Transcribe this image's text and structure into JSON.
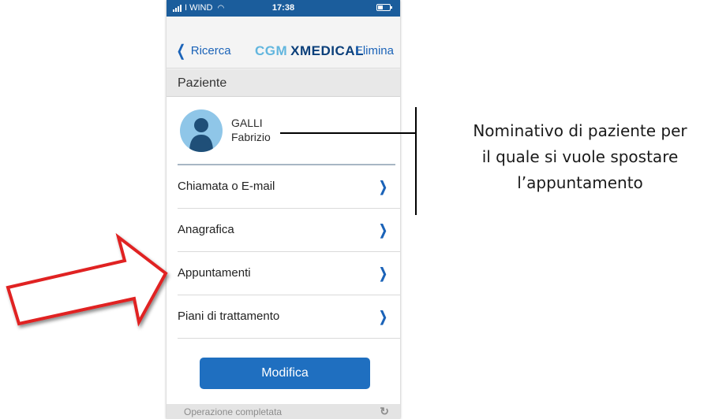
{
  "status_bar": {
    "carrier": "I WIND",
    "time": "17:38"
  },
  "nav": {
    "back_label": "Ricerca",
    "brand_cgm": "CGM",
    "brand_product": "XMEDICAL",
    "delete_label": "Elimina"
  },
  "section": {
    "title": "Paziente"
  },
  "patient": {
    "last_name": "GALLI",
    "first_name": "Fabrizio"
  },
  "menu": [
    {
      "label": "Chiamata o E-mail"
    },
    {
      "label": "Anagrafica"
    },
    {
      "label": "Appuntamenti"
    },
    {
      "label": "Piani di trattamento"
    }
  ],
  "actions": {
    "modify_label": "Modifica"
  },
  "footer": {
    "status": "Operazione completata"
  },
  "annotation": {
    "line1": "Nominativo di paziente per",
    "line2": "il quale si vuole spostare",
    "line3": "l’appuntamento"
  },
  "colors": {
    "accent": "#1b63b8",
    "brand_light": "#62b6de",
    "brand_dark": "#0b3f7a",
    "arrow": "#e02020"
  }
}
